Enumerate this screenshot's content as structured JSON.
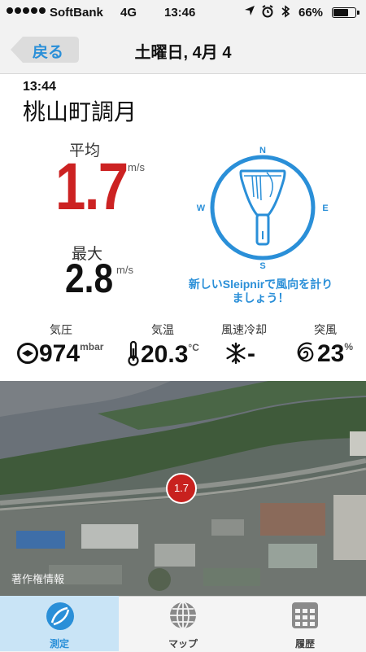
{
  "status_bar": {
    "carrier": "SoftBank",
    "network": "4G",
    "time": "13:46",
    "battery": "66%"
  },
  "nav": {
    "back_label": "戻る",
    "title": "土曜日, 4月 4"
  },
  "reading": {
    "time": "13:44",
    "location": "桃山町調月",
    "average_label": "平均",
    "average_value": "1.7",
    "average_unit": "m/s",
    "max_label": "最大",
    "max_value": "2.8",
    "max_unit": "m/s"
  },
  "compass": {
    "n": "N",
    "e": "E",
    "s": "S",
    "w": "W",
    "promo": "新しいSleipnirで風向を計りましょう！"
  },
  "stats": {
    "pressure_label": "気圧",
    "pressure_value": "974",
    "pressure_unit": "mbar",
    "temp_label": "気温",
    "temp_value": "20.3",
    "temp_unit": "°C",
    "windchill_label": "風速冷却",
    "windchill_value": "-",
    "gust_label": "突風",
    "gust_value": "23",
    "gust_unit": "%"
  },
  "map": {
    "marker_value": "1.7",
    "credit": "著作権情報"
  },
  "tabs": [
    {
      "label": "測定",
      "icon": "measure-icon",
      "active": true
    },
    {
      "label": "マップ",
      "icon": "globe-icon",
      "active": false
    },
    {
      "label": "履歴",
      "icon": "calendar-icon",
      "active": false
    }
  ],
  "colors": {
    "accent": "#2a8fd8",
    "average": "#cc2222",
    "marker": "#c8211e",
    "tab_active_bg": "#c9e4f6"
  }
}
